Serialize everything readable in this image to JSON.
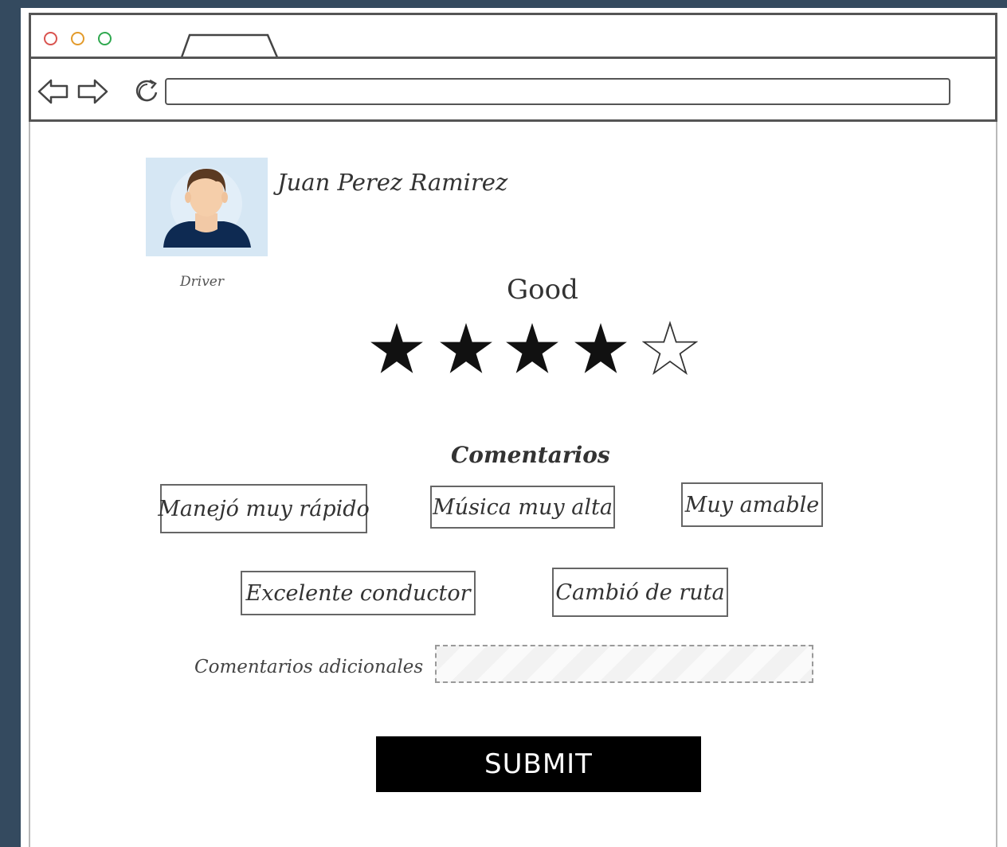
{
  "browser": {
    "dots": [
      {
        "name": "close-dot",
        "color": "#d9534f"
      },
      {
        "name": "minimize-dot",
        "color": "#e39b2b"
      },
      {
        "name": "maximize-dot",
        "color": "#2fa84f"
      }
    ],
    "url": ""
  },
  "profile": {
    "name": "Juan Perez Ramirez",
    "role": "Driver"
  },
  "rating": {
    "label": "Good",
    "value": 4,
    "max": 5
  },
  "comments": {
    "title": "Comentarios",
    "chips": [
      "Manejó muy rápido",
      "Música muy alta",
      "Muy amable",
      "Excelente conductor",
      "Cambió de ruta"
    ]
  },
  "additional": {
    "label": "Comentarios adicionales",
    "value": ""
  },
  "submit_label": "SUBMIT"
}
